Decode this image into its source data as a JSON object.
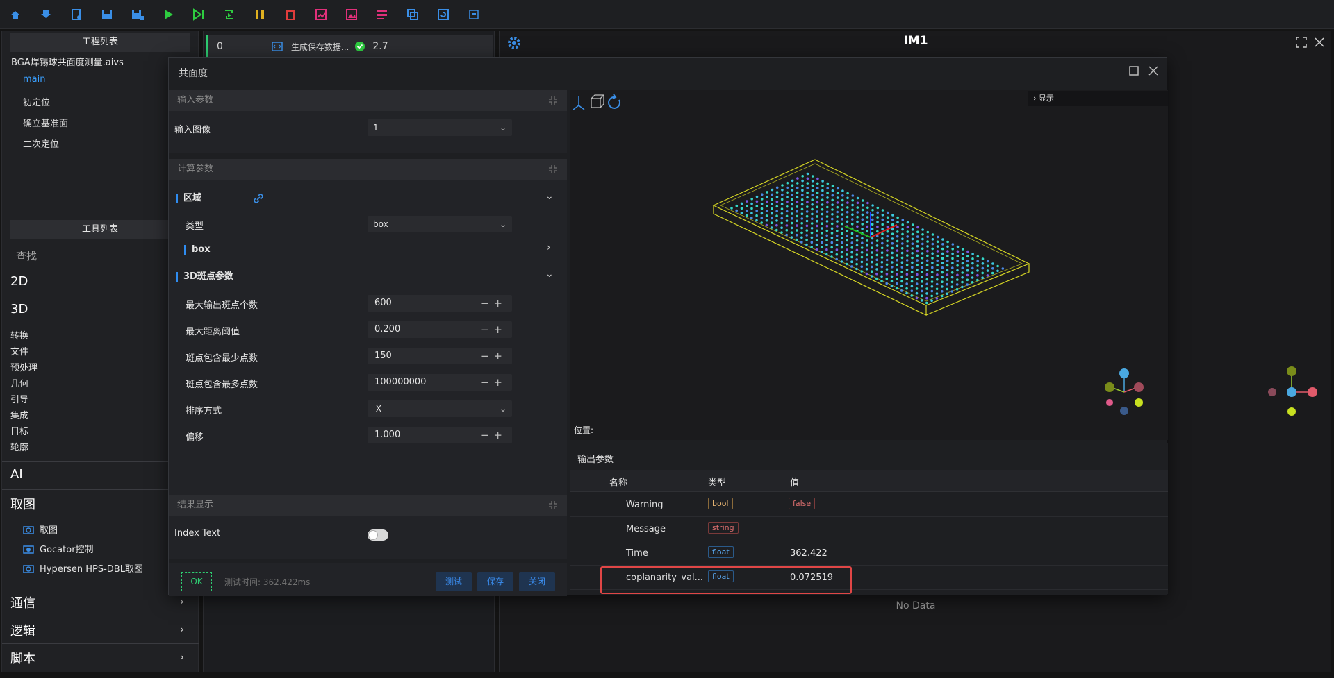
{
  "toolbar": {
    "icons": [
      "import-icon",
      "export-icon",
      "export-settings-icon",
      "save-icon",
      "save-as-icon",
      "run-icon",
      "step-run-icon",
      "loop-run-icon",
      "pause-icon",
      "delete-icon",
      "chart-icon",
      "image-icon",
      "list-icon",
      "copy-icon",
      "refresh-icon",
      "collapse-icon"
    ],
    "colors": {
      "blue": "#3a8ee6",
      "green": "#2ecc40",
      "yellow": "#e0b020",
      "red": "#e03c3c",
      "pink": "#e0307a"
    }
  },
  "left": {
    "project_header": "工程列表",
    "project_file": "BGA焊锡球共面度测量.aivs",
    "project_items": [
      "main",
      "初定位",
      "确立基准面",
      "二次定位"
    ],
    "tools_header": "工具列表",
    "search": "查找",
    "categories": {
      "c2d": "2D",
      "c3d": "3D",
      "sub3d": [
        "转换",
        "文件",
        "预处理",
        "几何",
        "引导",
        "集成",
        "目标",
        "轮廓"
      ],
      "ai": "AI",
      "capture": "取图",
      "capture_items": [
        "取图",
        "Gocator控制",
        "Hypersen HPS-DBL取图"
      ],
      "comm": "通信",
      "logic": "逻辑",
      "script": "脚本"
    }
  },
  "middle": {
    "node_index": "0",
    "node_label": "生成保存数据...",
    "node_time": "2.7"
  },
  "right": {
    "title": "IM1",
    "no_data": "No Data"
  },
  "dialog": {
    "title": "共面度",
    "input": {
      "header": "输入参数",
      "image_label": "输入图像",
      "image_value": "1"
    },
    "calc": {
      "header": "计算参数",
      "region_label": "区域",
      "type_label": "类型",
      "type_value": "box",
      "box_label": "box",
      "blob_label": "3D斑点参数",
      "params": [
        {
          "label": "最大输出斑点个数",
          "value": "600"
        },
        {
          "label": "最大距离阈值",
          "value": "0.200"
        },
        {
          "label": "斑点包含最少点数",
          "value": "150"
        },
        {
          "label": "斑点包含最多点数",
          "value": "100000000"
        }
      ],
      "sort_label": "排序方式",
      "sort_value": "-X",
      "offset_label": "偏移",
      "offset_value": "1.000"
    },
    "result": {
      "header": "结果显示",
      "index_text_label": "Index Text",
      "index_text_on": false
    },
    "footer": {
      "status": "OK",
      "test_time": "测试时间: 362.422ms",
      "test_btn": "测试",
      "save_btn": "保存",
      "close_btn": "关闭"
    },
    "view": {
      "display_label": "显示",
      "position_label": "位置:"
    },
    "output": {
      "title": "输出参数",
      "col_name": "名称",
      "col_type": "类型",
      "col_value": "值",
      "rows": [
        {
          "name": "Warning",
          "type": "bool",
          "value": "false"
        },
        {
          "name": "Message",
          "type": "string",
          "value": ""
        },
        {
          "name": "Time",
          "type": "float",
          "value": "362.422"
        },
        {
          "name": "coplanarity_val...",
          "type": "float",
          "value": "0.072519"
        }
      ]
    }
  }
}
